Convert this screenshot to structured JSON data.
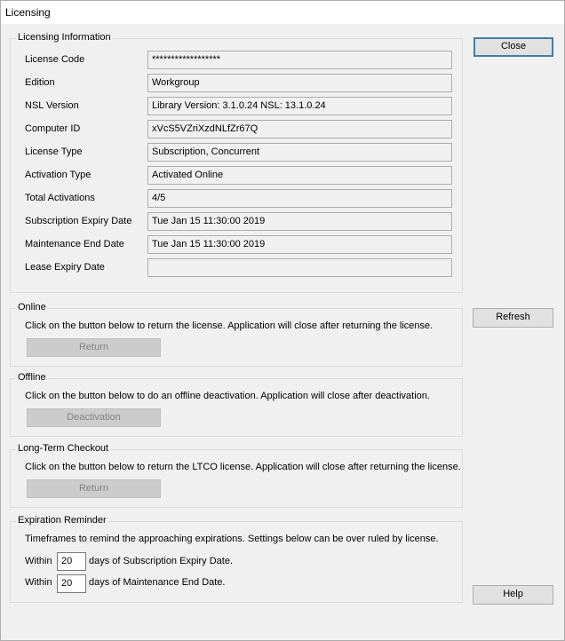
{
  "window": {
    "title": "Licensing"
  },
  "licensing_info": {
    "legend": "Licensing Information",
    "rows": [
      {
        "label": "License Code",
        "value": "******************"
      },
      {
        "label": "Edition",
        "value": "Workgroup"
      },
      {
        "label": "NSL Version",
        "value": "Library Version: 3.1.0.24 NSL: 13.1.0.24"
      },
      {
        "label": "Computer ID",
        "value": "xVcS5VZriXzdNLfZr67Q"
      },
      {
        "label": "License Type",
        "value": "Subscription, Concurrent"
      },
      {
        "label": "Activation Type",
        "value": "Activated Online"
      },
      {
        "label": "Total Activations",
        "value": "4/5"
      },
      {
        "label": "Subscription Expiry Date",
        "value": "Tue Jan 15 11:30:00 2019"
      },
      {
        "label": "Maintenance End Date",
        "value": "Tue Jan 15 11:30:00 2019"
      },
      {
        "label": "Lease Expiry Date",
        "value": ""
      }
    ]
  },
  "online": {
    "legend": "Online",
    "text": "Click on the button below to return the license. Application will close after returning the license.",
    "button": "Return"
  },
  "offline": {
    "legend": "Offline",
    "text": "Click on the button below to do an offline deactivation. Application will close after deactivation.",
    "button": "Deactivation"
  },
  "ltco": {
    "legend": "Long-Term Checkout",
    "text": "Click on the button below to return the LTCO license. Application will close after returning the license.",
    "button": "Return"
  },
  "reminder": {
    "legend": "Expiration Reminder",
    "text": "Timeframes to remind the approaching expirations. Settings below can be over ruled by license.",
    "rows": [
      {
        "prefix": "Within",
        "value": "20",
        "suffix": "days of Subscription Expiry Date."
      },
      {
        "prefix": "Within",
        "value": "20",
        "suffix": "days of Maintenance End Date."
      }
    ]
  },
  "buttons": {
    "close": "Close",
    "refresh": "Refresh",
    "help": "Help"
  }
}
